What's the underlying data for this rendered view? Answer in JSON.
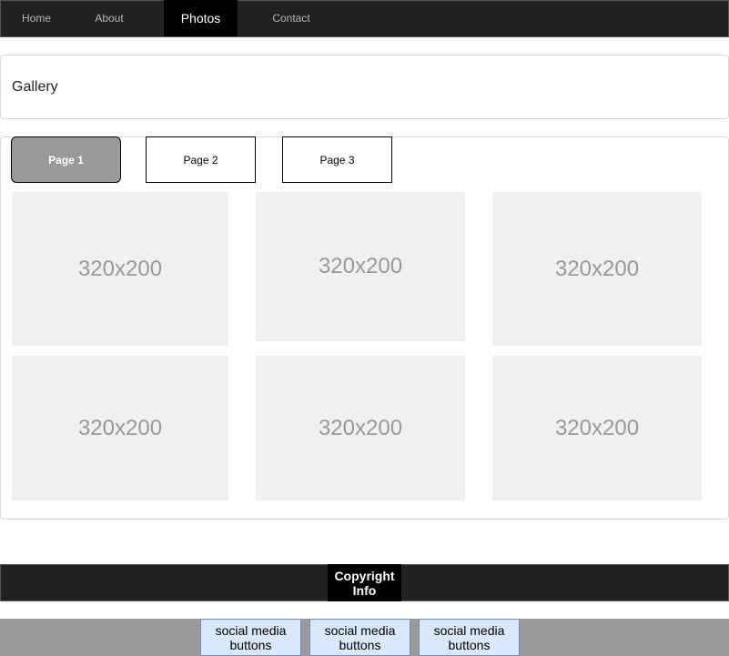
{
  "nav": {
    "items": [
      {
        "label": "Home"
      },
      {
        "label": "About"
      },
      {
        "label": "Photos",
        "active": true
      },
      {
        "label": "Contact"
      }
    ]
  },
  "gallery": {
    "title": "Gallery"
  },
  "pager": {
    "pages": [
      {
        "label": "Page 1",
        "active": true
      },
      {
        "label": "Page 2"
      },
      {
        "label": "Page 3"
      }
    ]
  },
  "thumbnails": [
    {
      "label": "320x200"
    },
    {
      "label": "320x200"
    },
    {
      "label": "320x200"
    },
    {
      "label": "320x200"
    },
    {
      "label": "320x200"
    },
    {
      "label": "320x200"
    }
  ],
  "footer": {
    "copyright": "Copyright\nInfo",
    "social_buttons": [
      {
        "label": "social media\nbuttons"
      },
      {
        "label": "social media\nbuttons"
      },
      {
        "label": "social media\nbuttons"
      }
    ]
  },
  "colors": {
    "nav_bg": "#222222",
    "nav_active_bg": "#000000",
    "thumb_bg": "#f0f0f0",
    "pager_active_bg": "#999999",
    "social_bg": "#dae8fc",
    "social_border": "#6c8ebf",
    "footer_gray": "#999999"
  }
}
